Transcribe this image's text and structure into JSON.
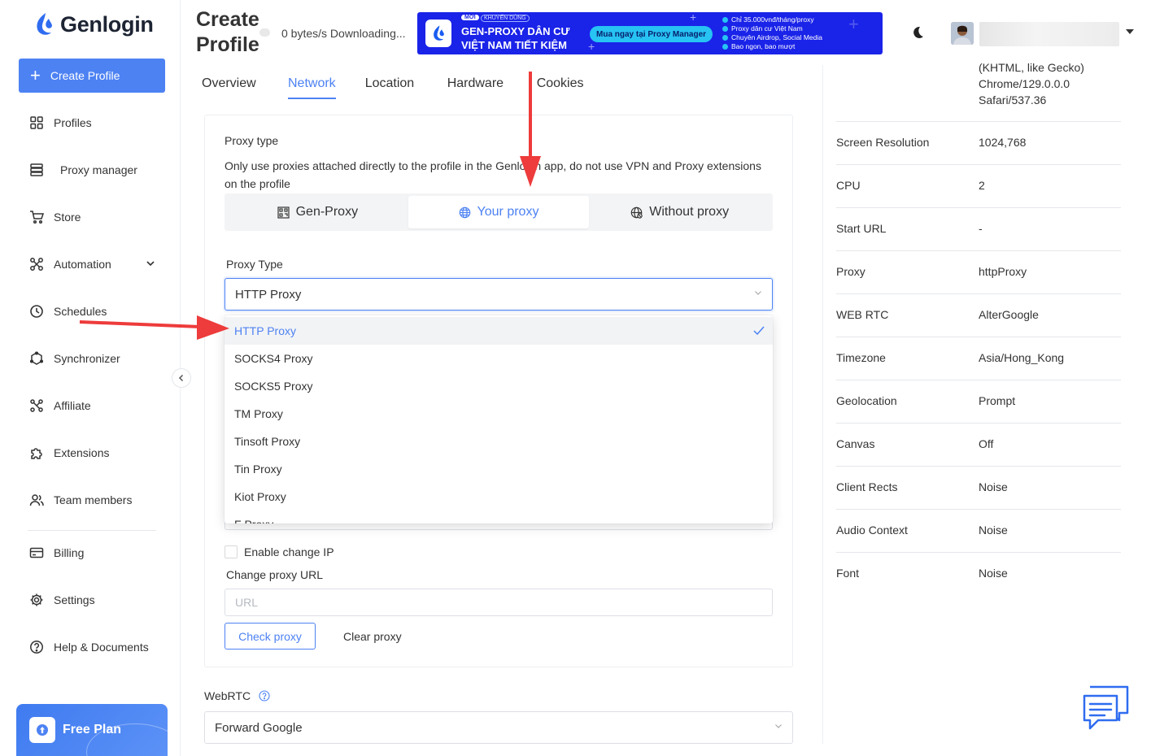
{
  "app": {
    "name": "Genlogin"
  },
  "sidebar": {
    "create_label": "Create Profile",
    "items": [
      {
        "label": "Profiles",
        "icon": "grid-icon"
      },
      {
        "label": "Proxy manager",
        "icon": "server-icon"
      },
      {
        "label": "Store",
        "icon": "cart-icon"
      },
      {
        "label": "Automation",
        "icon": "automation-icon"
      },
      {
        "label": "Schedules",
        "icon": "clock-icon"
      },
      {
        "label": "Synchronizer",
        "icon": "sync-icon"
      },
      {
        "label": "Affiliate",
        "icon": "affiliate-icon"
      },
      {
        "label": "Extensions",
        "icon": "puzzle-icon"
      },
      {
        "label": "Team members",
        "icon": "team-icon"
      },
      {
        "label": "Billing",
        "icon": "card-icon"
      },
      {
        "label": "Settings",
        "icon": "gear-icon"
      },
      {
        "label": "Help & Documents",
        "icon": "help-icon"
      }
    ],
    "plan_label": "Free Plan"
  },
  "header": {
    "title_line1": "Create",
    "title_line2": "Profile",
    "download_status": "0 bytes/s Downloading...",
    "banner": {
      "badge_new": "MỚI",
      "badge_tag": "KHUYẾN DÙNG",
      "headline_1": "GEN-PROXY DÂN CƯ",
      "headline_2": "VIỆT NAM TIẾT KIỆM",
      "cta": "Mua ngay tại Proxy Manager",
      "bullets": [
        "Chỉ 35.000vnđ/tháng/proxy",
        "Proxy dân cư Việt Nam",
        "Chuyên Airdrop, Social Media",
        "Bao ngon, bao mượt"
      ]
    }
  },
  "tabs": [
    "Overview",
    "Network",
    "Location",
    "Hardware",
    "Cookies"
  ],
  "active_tab": "Network",
  "proxy": {
    "section_label": "Proxy type",
    "note": "Only use proxies attached directly to the profile in the Genlogin app, do not use VPN and Proxy extensions on the profile",
    "modes": [
      "Gen-Proxy",
      "Your proxy",
      "Without proxy"
    ],
    "active_mode": "Your proxy",
    "type_label": "Proxy Type",
    "type_value": "HTTP Proxy",
    "options": [
      "HTTP Proxy",
      "SOCKS4 Proxy",
      "SOCKS5 Proxy",
      "TM Proxy",
      "Tinsoft Proxy",
      "Tin Proxy",
      "Kiot Proxy",
      "F Proxy"
    ],
    "selected_option": "HTTP Proxy",
    "enable_change_ip": "Enable change IP",
    "change_url_label": "Change proxy URL",
    "url_placeholder": "URL",
    "check_label": "Check proxy",
    "clear_label": "Clear proxy"
  },
  "webrtc": {
    "label": "WebRTC",
    "value": "Forward Google"
  },
  "overview": {
    "ua_tail": [
      "(KHTML, like Gecko)",
      "Chrome/129.0.0.0",
      "Safari/537.36"
    ],
    "rows": [
      {
        "key": "Screen Resolution",
        "value": "1024,768"
      },
      {
        "key": "CPU",
        "value": "2"
      },
      {
        "key": "Start URL",
        "value": "-"
      },
      {
        "key": "Proxy",
        "value": "httpProxy"
      },
      {
        "key": "WEB RTC",
        "value": "AlterGoogle"
      },
      {
        "key": "Timezone",
        "value": "Asia/Hong_Kong"
      },
      {
        "key": "Geolocation",
        "value": "Prompt"
      },
      {
        "key": "Canvas",
        "value": "Off"
      },
      {
        "key": "Client Rects",
        "value": "Noise"
      },
      {
        "key": "Audio Context",
        "value": "Noise"
      },
      {
        "key": "Font",
        "value": "Noise"
      }
    ]
  },
  "colors": {
    "accent": "#4d82f3",
    "banner": "#1a23e8",
    "arrow": "#ee3b3b"
  }
}
